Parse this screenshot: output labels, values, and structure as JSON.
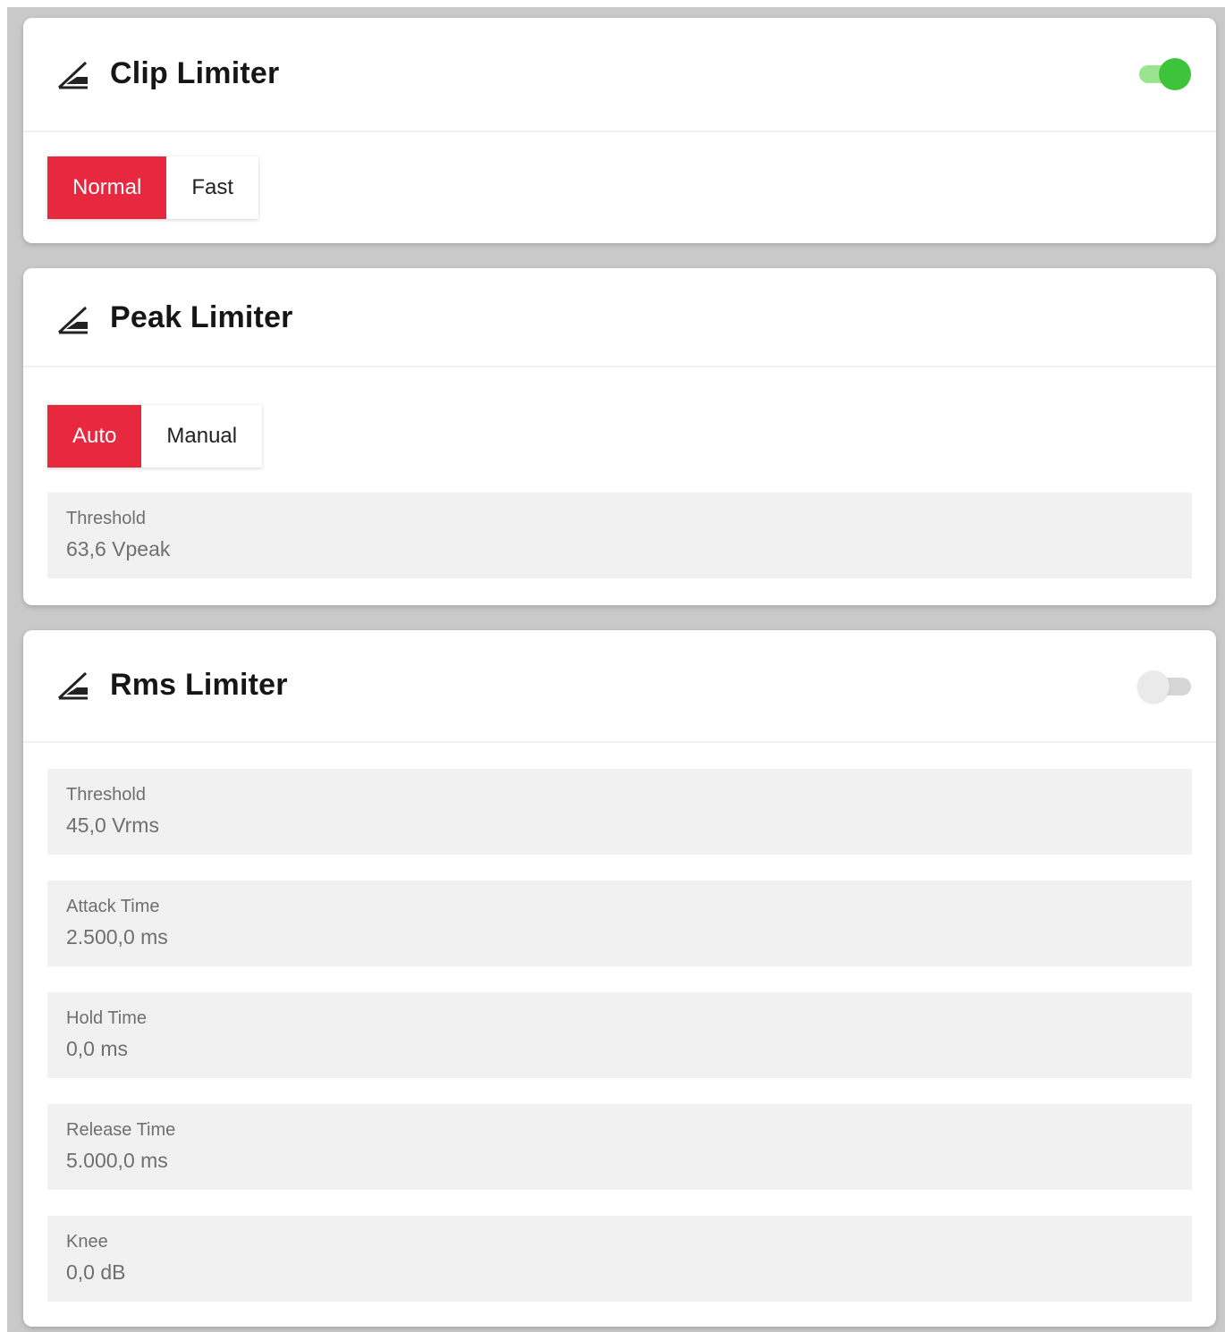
{
  "clip_limiter": {
    "title": "Clip Limiter",
    "enabled": true,
    "modes": [
      "Normal",
      "Fast"
    ],
    "selected_mode": "Normal"
  },
  "peak_limiter": {
    "title": "Peak Limiter",
    "modes": [
      "Auto",
      "Manual"
    ],
    "selected_mode": "Auto",
    "threshold": {
      "label": "Threshold",
      "value": "63,6 Vpeak"
    }
  },
  "rms_limiter": {
    "title": "Rms Limiter",
    "enabled": false,
    "threshold": {
      "label": "Threshold",
      "value": "45,0 Vrms"
    },
    "attack_time": {
      "label": "Attack Time",
      "value": "2.500,0 ms"
    },
    "hold_time": {
      "label": "Hold Time",
      "value": "0,0 ms"
    },
    "release_time": {
      "label": "Release Time",
      "value": "5.000,0 ms"
    },
    "knee": {
      "label": "Knee",
      "value": "0,0 dB"
    }
  },
  "colors": {
    "accent": "#e8283e",
    "toggle_on": "#3ec43a",
    "toggle_on_track": "#9be38e",
    "toggle_off": "#eaeaea",
    "field_bg": "#f1f1f1",
    "page_bg": "#c9c9c9"
  },
  "icons": {
    "limiter": "limiter-icon"
  }
}
